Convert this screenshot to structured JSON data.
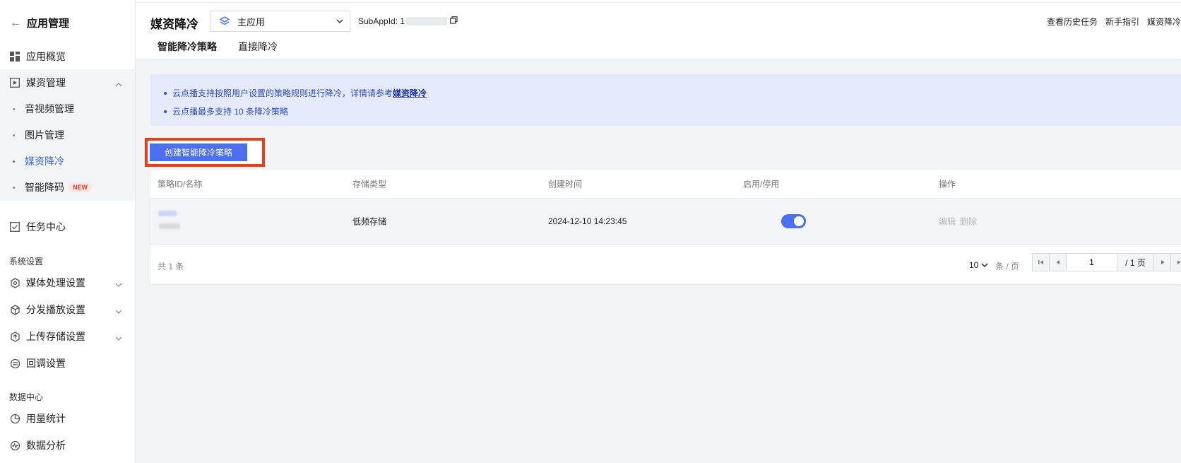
{
  "sidebar": {
    "back_label": "应用管理",
    "items": [
      {
        "label": "应用概览"
      },
      {
        "label": "媒资管理"
      },
      {
        "label": "音视频管理"
      },
      {
        "label": "图片管理"
      },
      {
        "label": "媒资降冷"
      },
      {
        "label": "智能降码",
        "badge": "NEW"
      },
      {
        "label": "任务中心"
      }
    ],
    "section_system": "系统设置",
    "system_items": [
      {
        "label": "媒体处理设置"
      },
      {
        "label": "分发播放设置"
      },
      {
        "label": "上传存储设置"
      },
      {
        "label": "回调设置"
      }
    ],
    "section_data": "数据中心",
    "data_items": [
      {
        "label": "用量统计"
      },
      {
        "label": "数据分析"
      }
    ]
  },
  "header": {
    "title": "媒资降冷",
    "app_select_value": "主应用",
    "subappid_label": "SubAppId: 1",
    "links": [
      "查看历史任务",
      "新手指引",
      "媒资降冷"
    ],
    "tabs": [
      {
        "label": "智能降冷策略",
        "active": true
      },
      {
        "label": "直接降冷",
        "active": false
      }
    ]
  },
  "notice": {
    "line1_text": "云点播支持按照用户设置的策略规则进行降冷，详情请参考",
    "line1_link": "媒资降冷",
    "line2_text": "云点播最多支持 10 条降冷策略"
  },
  "create_button_label": "创建智能降冷策略",
  "table": {
    "columns": [
      "策略ID/名称",
      "存储类型",
      "创建时间",
      "启用/停用",
      "操作"
    ],
    "rows": [
      {
        "storage_type": "低频存储",
        "created_at": "2024-12-10 14:23:45",
        "enabled": true,
        "actions": [
          "编辑",
          "删除"
        ]
      }
    ]
  },
  "pagination": {
    "total_label": "共 1 条",
    "page_size": "10",
    "page_size_unit": "条 / 页",
    "current_page": "1",
    "total_pages_label": "/ 1 页"
  },
  "colors": {
    "accent": "#3b6df0",
    "button": "#4c6ff0",
    "highlight_border": "#e3401b",
    "notice_bg": "#e5ebfc"
  }
}
